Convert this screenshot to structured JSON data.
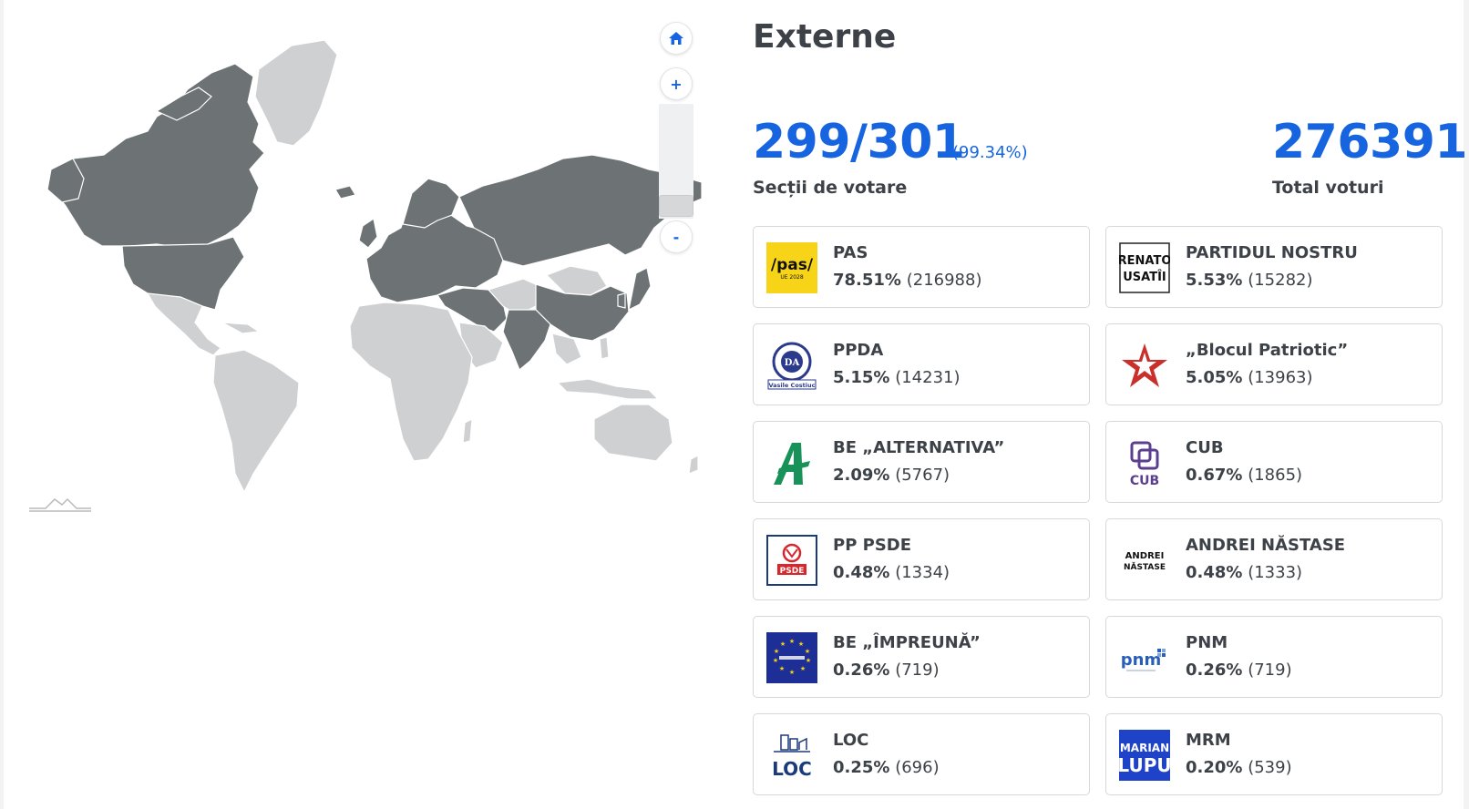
{
  "region_title": "Externe",
  "stations": {
    "counted": "299/301",
    "percent": "(99.34%)",
    "label": "Secții de votare"
  },
  "total": {
    "value": "276391",
    "label": "Total voturi"
  },
  "map_controls": {
    "home": "⌂",
    "zoom_in": "+",
    "zoom_out": "-"
  },
  "colors": {
    "accent": "#1664e0",
    "map_dark": "#6d7275",
    "map_light": "#cfd0d1"
  },
  "parties": [
    {
      "name": "PAS",
      "percent": "78.51%",
      "votes": "(216988)",
      "logo": "pas-logo",
      "logo_text": "/pas/",
      "logo_sub": "UE 2028"
    },
    {
      "name": "PARTIDUL NOSTRU",
      "percent": "5.53%",
      "votes": "(15282)",
      "logo": "renato-usatii-logo",
      "logo_text": "RENATO",
      "logo_sub": "USATÎI"
    },
    {
      "name": "PPDA",
      "percent": "5.15%",
      "votes": "(14231)",
      "logo": "ppda-logo",
      "logo_text": "DA",
      "logo_sub": "Vasile Costiuc"
    },
    {
      "name": "„Blocul Patriotic”",
      "percent": "5.05%",
      "votes": "(13963)",
      "logo": "blocul-patriotic-star-logo"
    },
    {
      "name": "BE „ALTERNATIVA”",
      "percent": "2.09%",
      "votes": "(5767)",
      "logo": "alternativa-logo"
    },
    {
      "name": "CUB",
      "percent": "0.67%",
      "votes": "(1865)",
      "logo": "cub-logo",
      "logo_text": "CUB"
    },
    {
      "name": "PP PSDE",
      "percent": "0.48%",
      "votes": "(1334)",
      "logo": "psde-logo",
      "logo_text": "PSDE"
    },
    {
      "name": "ANDREI NĂSTASE",
      "percent": "0.48%",
      "votes": "(1333)",
      "logo": "andrei-nastase-logo",
      "logo_text": "ANDREI",
      "logo_sub": "NĂSTASE"
    },
    {
      "name": "BE „ÎMPREUNĂ”",
      "percent": "0.26%",
      "votes": "(719)",
      "logo": "impreuna-eu-flag-logo"
    },
    {
      "name": "PNM",
      "percent": "0.26%",
      "votes": "(719)",
      "logo": "pnm-logo",
      "logo_text": "pnm"
    },
    {
      "name": "LOC",
      "percent": "0.25%",
      "votes": "(696)",
      "logo": "loc-logo",
      "logo_text": "LOC"
    },
    {
      "name": "MRM",
      "percent": "0.20%",
      "votes": "(539)",
      "logo": "marian-lupu-logo",
      "logo_text": "MARIAN",
      "logo_sub": "LUPU"
    }
  ]
}
